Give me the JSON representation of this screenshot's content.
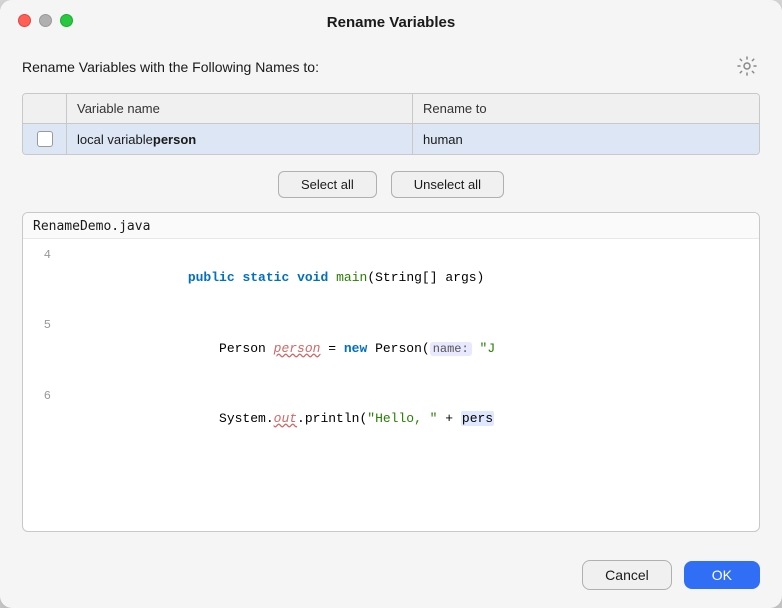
{
  "window": {
    "title": "Rename Variables",
    "traffic_lights": {
      "close": "close",
      "minimize": "minimize",
      "maximize": "maximize"
    }
  },
  "header": {
    "label": "Rename Variables with the Following Names to:",
    "gear_icon": "settings-icon"
  },
  "table": {
    "columns": [
      "",
      "Variable name",
      "Rename to"
    ],
    "rows": [
      {
        "checked": false,
        "variable_prefix": "local variable ",
        "variable_bold": "person",
        "rename_to": "human"
      }
    ]
  },
  "buttons": {
    "select_all": "Select all",
    "unselect_all": "Unselect all"
  },
  "code": {
    "filename": "RenameDemo.java",
    "lines": [
      {
        "num": "4",
        "content": "    public static void main(String[] args)"
      },
      {
        "num": "5",
        "content": "        Person person = new Person( name: \"J"
      },
      {
        "num": "6",
        "content": "        System.out.println(\"Hello, \" + pers"
      }
    ]
  },
  "footer": {
    "cancel": "Cancel",
    "ok": "OK"
  }
}
